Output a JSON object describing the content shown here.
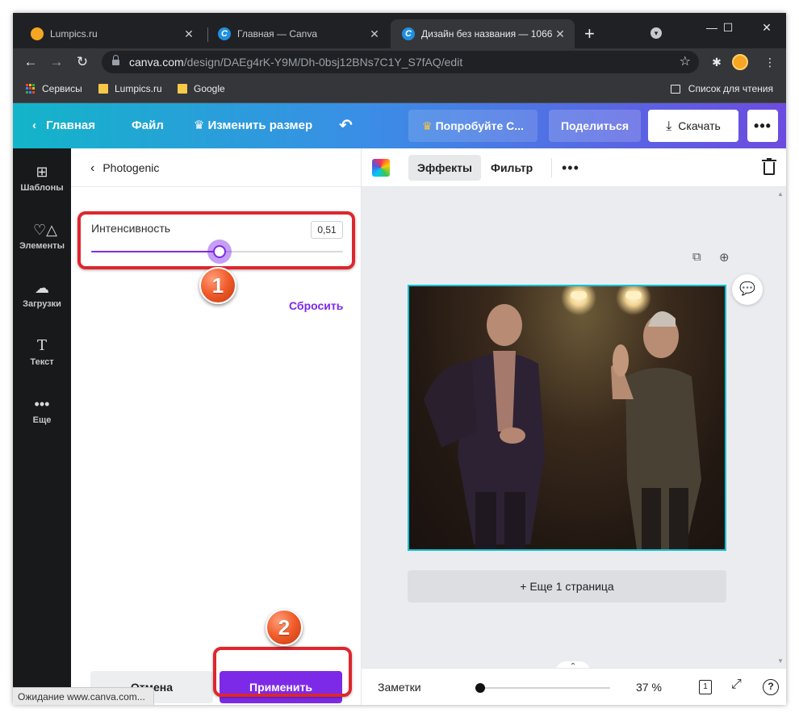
{
  "browser": {
    "tabs": [
      {
        "title": "Lumpics.ru",
        "icon": "lumpics-favicon"
      },
      {
        "title": "Главная — Canva",
        "icon": "canva-favicon"
      },
      {
        "title": "Дизайн без названия — 1066",
        "icon": "canva-favicon",
        "active": true
      }
    ],
    "new_tab_glyph": "+",
    "url_host": "canva.com",
    "url_path": "/design/DAEg4rK-Y9M/Dh-0bsj12BNs7C1Y_S7fAQ/edit",
    "bookmarks": [
      {
        "label": "Сервисы",
        "icon": "apps-grid-icon"
      },
      {
        "label": "Lumpics.ru",
        "icon": "folder-icon"
      },
      {
        "label": "Google",
        "icon": "folder-icon"
      }
    ],
    "reading_list": "Список для чтения",
    "status_text": "Ожидание www.canva.com..."
  },
  "canva_header": {
    "back_label": "Главная",
    "file_label": "Файл",
    "resize_label": "Изменить размер",
    "try_label": "Попробуйте С...",
    "share_label": "Поделиться",
    "download_label": "Скачать"
  },
  "rail": [
    {
      "label": "Шаблоны",
      "icon": "templates-icon"
    },
    {
      "label": "Элементы",
      "icon": "elements-icon"
    },
    {
      "label": "Загрузки",
      "icon": "upload-icon"
    },
    {
      "label": "Текст",
      "icon": "text-icon"
    },
    {
      "label": "Еще",
      "icon": "more-icon"
    }
  ],
  "panel": {
    "title": "Photogenic",
    "intensity_label": "Интенсивность",
    "intensity_value": "0,51",
    "intensity_fraction": 0.51,
    "reset_label": "Сбросить",
    "cancel_label": "Отмена",
    "apply_label": "Применить"
  },
  "editor": {
    "effects_label": "Эффекты",
    "filter_label": "Фильтр",
    "more_pages_label": "+ Еще 1 страница",
    "notes_label": "Заметки",
    "zoom_label": "37 %",
    "page_count": "1"
  },
  "annotations": [
    "1",
    "2"
  ],
  "colors": {
    "accent": "#7d2ae8",
    "highlight": "#e0262d",
    "selection": "#13c0d3"
  }
}
